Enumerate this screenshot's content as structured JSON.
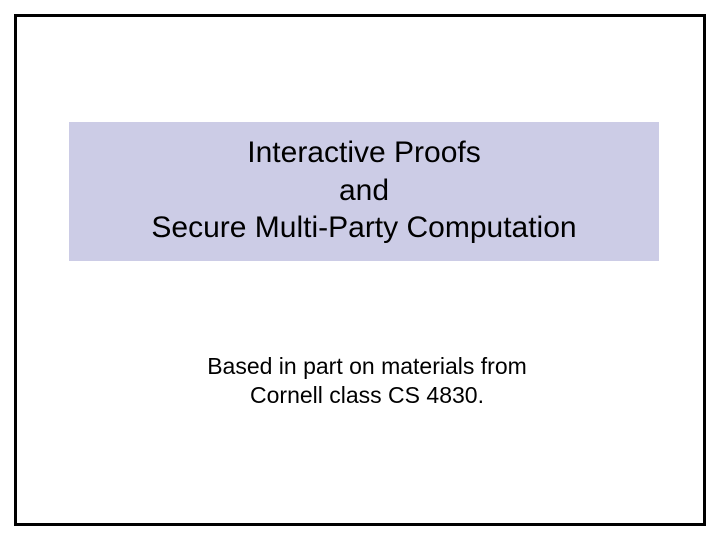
{
  "title": {
    "line1": "Interactive Proofs",
    "line2": "and",
    "line3": "Secure Multi-Party Computation"
  },
  "subtitle": {
    "line1": "Based in part on materials from",
    "line2": "Cornell class CS 4830."
  }
}
